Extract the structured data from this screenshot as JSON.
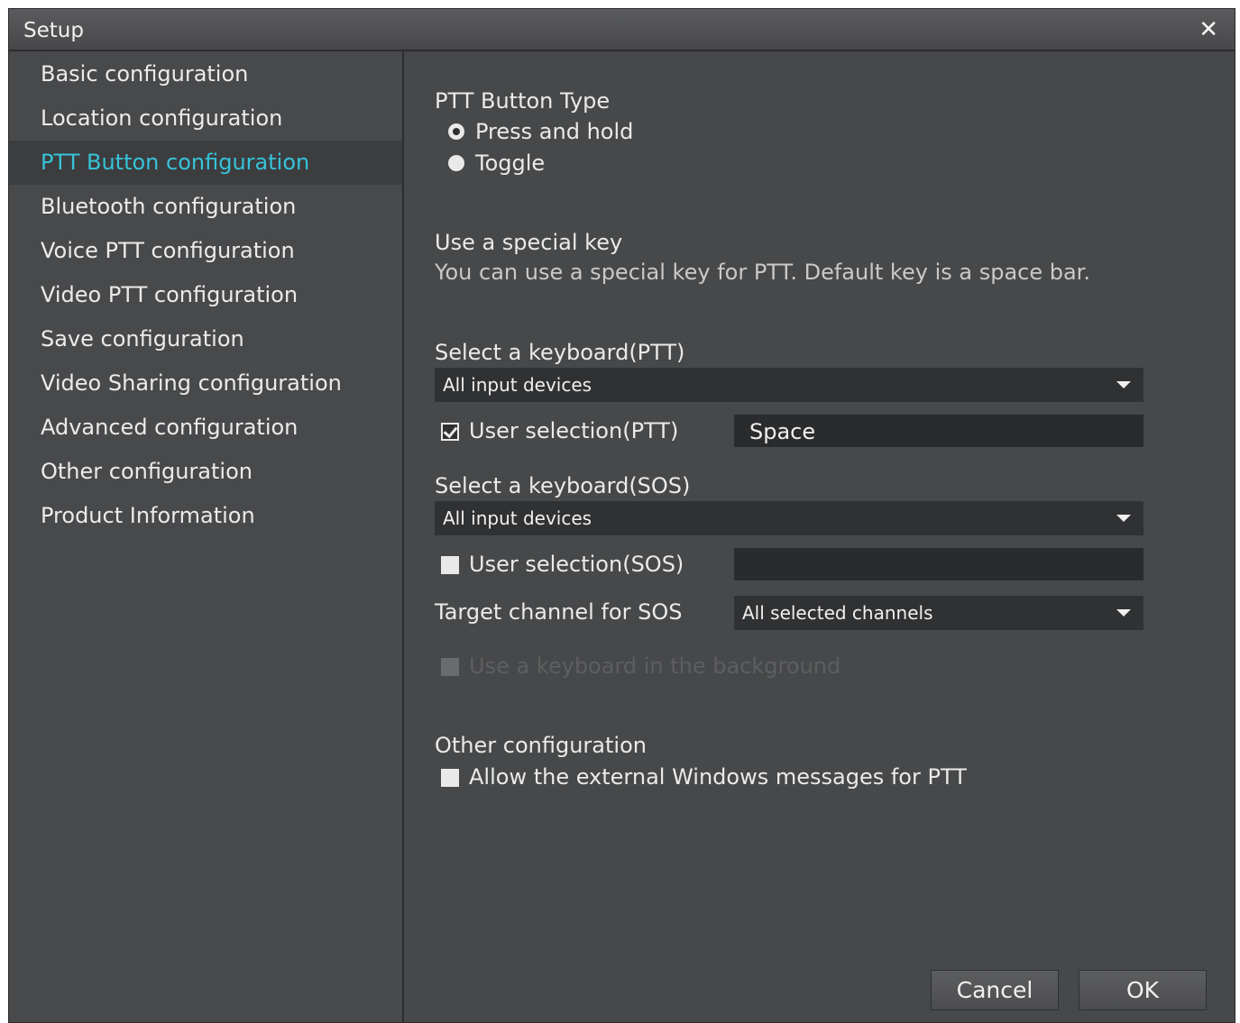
{
  "window": {
    "title": "Setup"
  },
  "sidebar": {
    "items": [
      {
        "label": "Basic configuration"
      },
      {
        "label": "Location configuration"
      },
      {
        "label": "PTT Button configuration"
      },
      {
        "label": "Bluetooth configuration"
      },
      {
        "label": "Voice PTT configuration"
      },
      {
        "label": "Video PTT configuration"
      },
      {
        "label": "Save configuration"
      },
      {
        "label": "Video Sharing configuration"
      },
      {
        "label": "Advanced configuration"
      },
      {
        "label": "Other configuration"
      },
      {
        "label": "Product Information"
      }
    ],
    "active_index": 2
  },
  "ptt_type": {
    "heading": "PTT Button Type",
    "options": [
      "Press and hold",
      "Toggle"
    ],
    "selected": "Press and hold"
  },
  "special_key": {
    "heading": "Use a special key",
    "description": "You can use a special key for PTT. Default key is a space bar."
  },
  "ptt_keyboard": {
    "label": "Select a keyboard(PTT)",
    "value": "All input devices",
    "user_selection_label": "User selection(PTT)",
    "user_selection_checked": true,
    "key_value": "Space"
  },
  "sos_keyboard": {
    "label": "Select a keyboard(SOS)",
    "value": "All input devices",
    "user_selection_label": "User selection(SOS)",
    "user_selection_checked": false,
    "key_value": ""
  },
  "sos_target": {
    "label": "Target channel for SOS",
    "value": "All selected channels"
  },
  "background_keyboard": {
    "label": "Use a keyboard in the background",
    "enabled": false,
    "checked": false
  },
  "other": {
    "heading": "Other configuration",
    "external_messages_label": "Allow the external Windows messages for PTT",
    "external_messages_checked": false
  },
  "buttons": {
    "cancel": "Cancel",
    "ok": "OK"
  },
  "colors": {
    "accent": "#36c3d9",
    "background": "#474849",
    "field": "#303133"
  }
}
